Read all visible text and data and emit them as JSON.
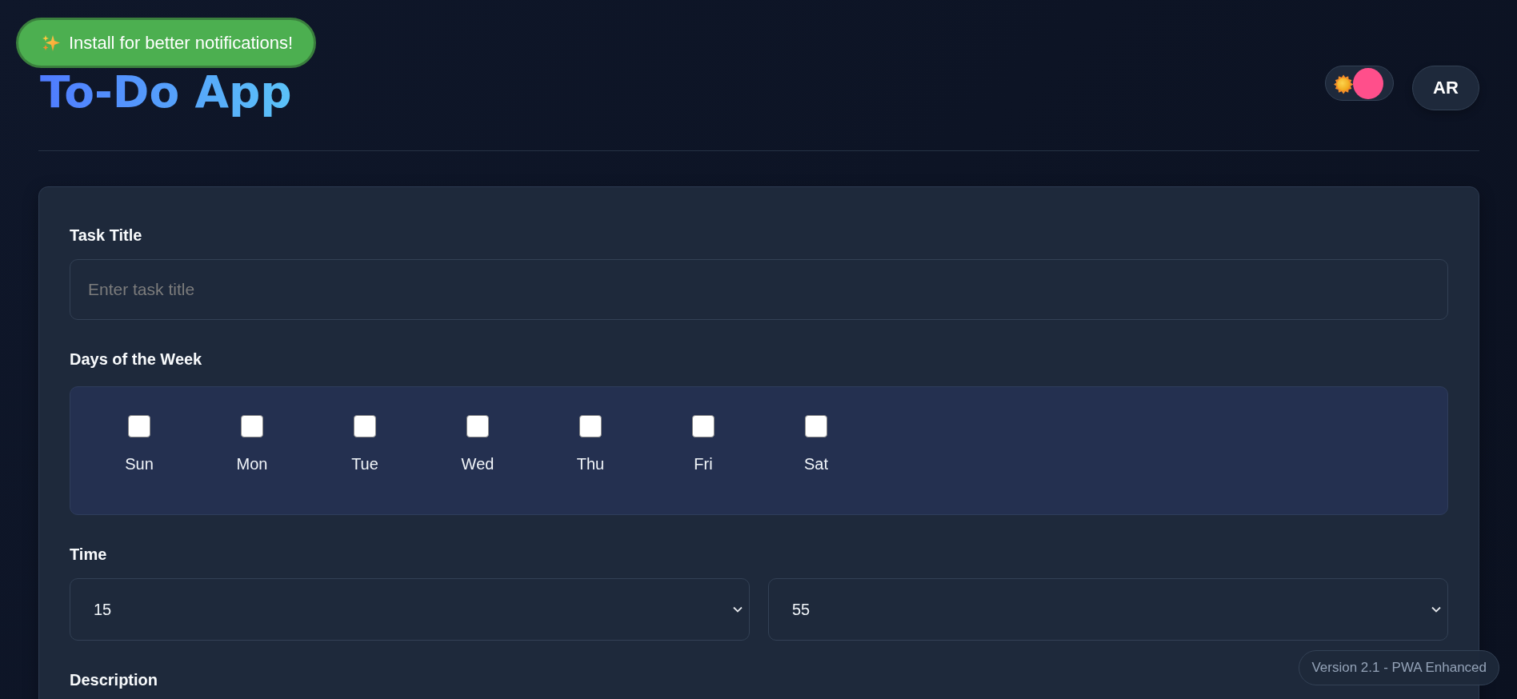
{
  "install_banner": {
    "text": "Install for better notifications!"
  },
  "header": {
    "title": "To-Do App",
    "theme_toggle": {
      "on": true
    },
    "language_button": "AR"
  },
  "form": {
    "task_title": {
      "label": "Task Title",
      "placeholder": "Enter task title"
    },
    "days": {
      "label": "Days of the Week",
      "items": [
        {
          "label": "Sun",
          "checked": false
        },
        {
          "label": "Mon",
          "checked": false
        },
        {
          "label": "Tue",
          "checked": false
        },
        {
          "label": "Wed",
          "checked": false
        },
        {
          "label": "Thu",
          "checked": false
        },
        {
          "label": "Fri",
          "checked": false
        },
        {
          "label": "Sat",
          "checked": false
        }
      ]
    },
    "time": {
      "label": "Time",
      "hour": "15",
      "minute": "55"
    },
    "description": {
      "label": "Description"
    }
  },
  "version_badge": "Version 2.1 - PWA Enhanced"
}
